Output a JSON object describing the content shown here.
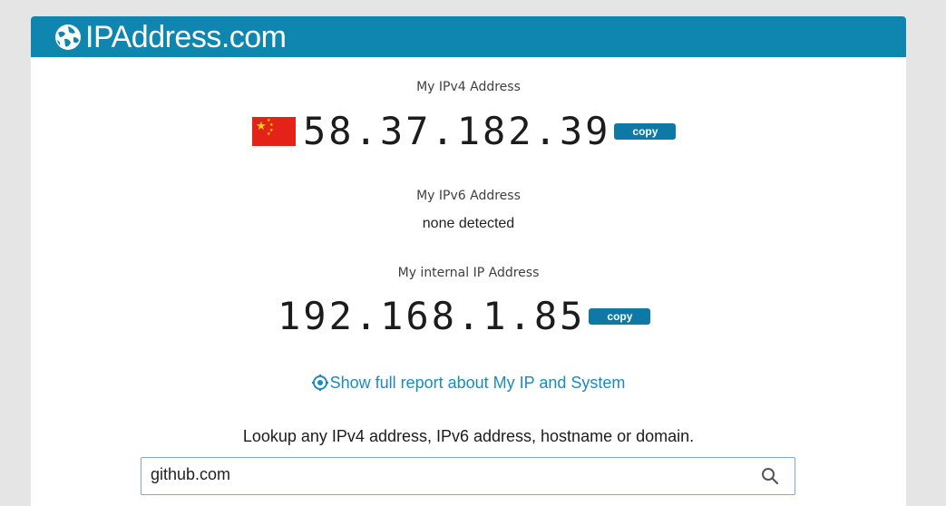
{
  "header": {
    "title": "IPAddress.com",
    "logo_icon": "globe-icon",
    "background": "#0f86b0"
  },
  "ipv4": {
    "label": "My IPv4 Address",
    "address": "58.37.182.39",
    "flag": "china-flag-icon",
    "copy_label": "copy"
  },
  "ipv6": {
    "label": "My IPv6 Address",
    "value": "none detected"
  },
  "internal": {
    "label": "My internal IP Address",
    "address": "192.168.1.85",
    "copy_label": "copy"
  },
  "report": {
    "link_label": "Show full report about My IP and System",
    "icon": "target-icon"
  },
  "lookup": {
    "text": "Lookup any IPv4 address, IPv6 address, hostname or domain.",
    "input_value": "github.com",
    "search_icon": "search-icon"
  }
}
